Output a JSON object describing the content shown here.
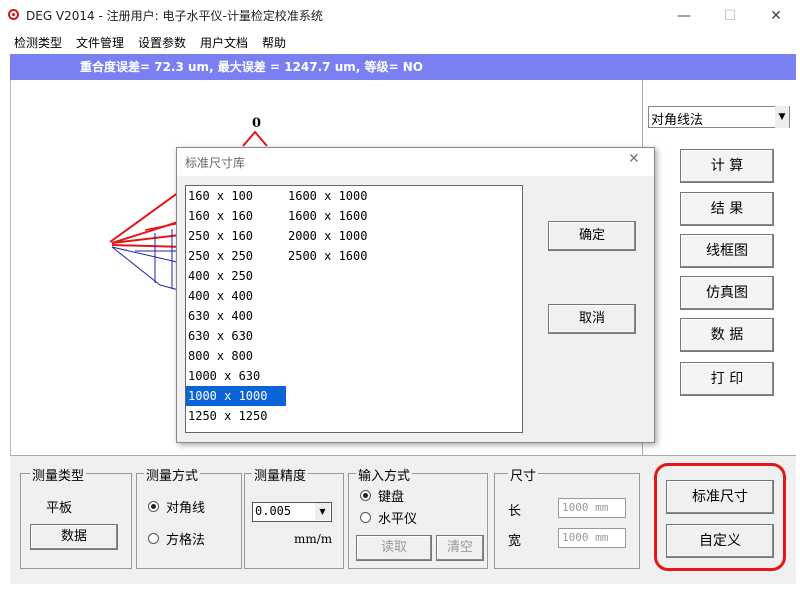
{
  "window": {
    "title": "DEG V2014 -  注册用户:  电子水平仪-计量检定校准系统",
    "minimize": "—",
    "maximize": "☐",
    "close": "✕"
  },
  "menu": [
    "检测类型",
    "文件管理",
    "设置参数",
    "用户文档",
    "帮助"
  ],
  "status": "重合度误差= 72.3 um,  最大误差 = 1247.7 um,  等级= NO",
  "canvas": {
    "marker_label": "0"
  },
  "right_panel": {
    "method": "对角线法",
    "buttons": [
      "计 算",
      "结 果",
      "线框图",
      "仿真图",
      "数 据",
      "打 印"
    ]
  },
  "bottom": {
    "measure_type": {
      "label": "测量类型",
      "value": "平板",
      "button": "数据"
    },
    "measure_method": {
      "label": "测量方式",
      "options": [
        "对角线",
        "方格法"
      ],
      "selected": 0
    },
    "precision": {
      "label": "测量精度",
      "value": "0.005",
      "unit": "mm/m"
    },
    "input_mode": {
      "label": "输入方式",
      "options": [
        "键盘",
        "水平仪"
      ],
      "selected": 0,
      "read_button": "读取",
      "clear_button": "清空"
    },
    "size": {
      "label": "尺寸",
      "length_label": "长",
      "length_value": "1000 mm",
      "width_label": "宽",
      "width_value": "1000 mm"
    },
    "standard_button": "标准尺寸",
    "custom_button": "自定义"
  },
  "dialog": {
    "title": "标准尺寸库",
    "close": "✕",
    "column1": [
      "160 x 100",
      "160 x 160",
      "250 x 160",
      "250 x 250",
      "400 x 250",
      "400 x 400",
      "630 x 400",
      "630 x 630",
      "800 x 800",
      "1000 x 630",
      "1000 x 1000",
      "1250 x 1250"
    ],
    "column2": [
      "1600 x 1000",
      "1600 x 1600",
      "2000 x 1000",
      "2500 x 1600"
    ],
    "selected_item": "1000 x 1000",
    "ok_button": "确定",
    "cancel_button": "取消"
  },
  "colors": {
    "status_strip": "#7a80f2",
    "selection": "#0a64d8",
    "highlight": "#e01818"
  }
}
